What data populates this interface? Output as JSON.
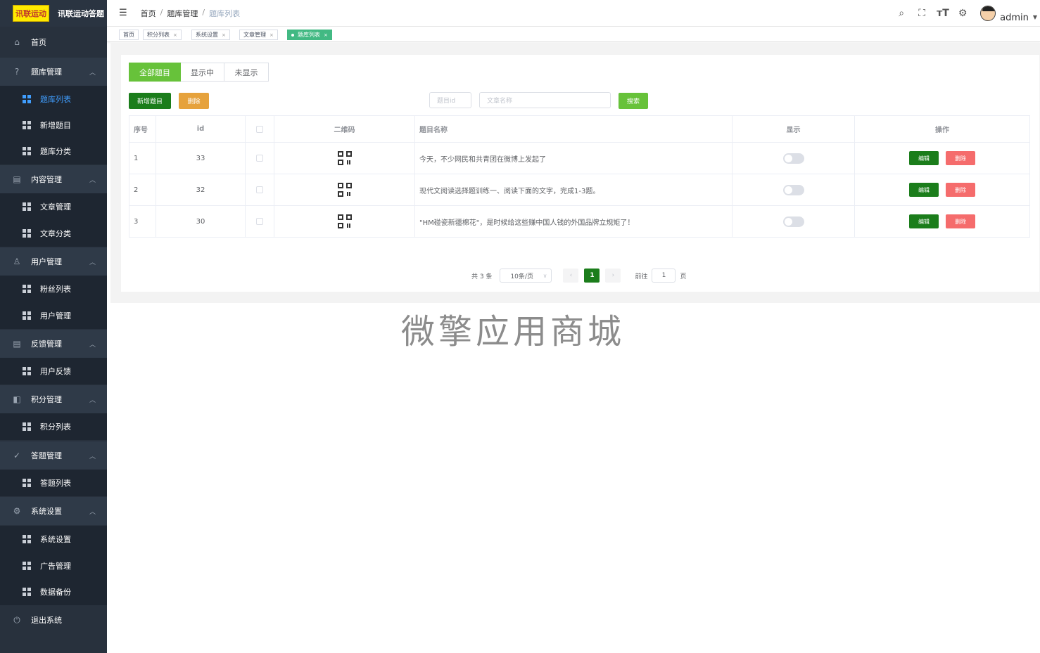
{
  "app": {
    "badge": "讯联运动",
    "title": "讯联运动答题"
  },
  "sidebar": {
    "items": [
      {
        "label": "首页",
        "icon": "home-icon",
        "glyph": "⌂"
      },
      {
        "label": "题库管理",
        "icon": "question-icon",
        "glyph": "?",
        "children": [
          {
            "label": "题库列表",
            "active": true
          },
          {
            "label": "新增题目"
          },
          {
            "label": "题库分类"
          }
        ]
      },
      {
        "label": "内容管理",
        "icon": "document-icon",
        "glyph": "▤",
        "children": [
          {
            "label": "文章管理"
          },
          {
            "label": "文章分类"
          }
        ]
      },
      {
        "label": "用户管理",
        "icon": "user-icon",
        "glyph": "♙",
        "children": [
          {
            "label": "粉丝列表"
          },
          {
            "label": "用户管理"
          }
        ]
      },
      {
        "label": "反馈管理",
        "icon": "feedback-icon",
        "glyph": "▤",
        "children": [
          {
            "label": "用户反馈"
          }
        ]
      },
      {
        "label": "积分管理",
        "icon": "points-icon",
        "glyph": "◧",
        "children": [
          {
            "label": "积分列表"
          }
        ]
      },
      {
        "label": "答题管理",
        "icon": "check-circle-icon",
        "glyph": "✓",
        "children": [
          {
            "label": "答题列表"
          }
        ]
      },
      {
        "label": "系统设置",
        "icon": "gear-icon",
        "glyph": "⚙",
        "children": [
          {
            "label": "系统设置"
          },
          {
            "label": "广告管理"
          },
          {
            "label": "数据备份"
          }
        ]
      },
      {
        "label": "退出系统",
        "icon": "power-icon",
        "glyph": "⏻"
      }
    ]
  },
  "header": {
    "breadcrumb": [
      "首页",
      "题库管理",
      "题库列表"
    ],
    "user": "admin"
  },
  "tags": [
    {
      "label": "首页",
      "closable": false
    },
    {
      "label": "积分列表",
      "closable": true
    },
    {
      "label": "系统设置",
      "closable": true
    },
    {
      "label": "文章管理",
      "closable": true
    },
    {
      "label": "题库列表",
      "closable": true,
      "active": true
    }
  ],
  "filter_tabs": [
    "全部题目",
    "显示中",
    "未显示"
  ],
  "toolbar": {
    "add_label": "新增题目",
    "delete_label": "删除",
    "id_placeholder": "题目id",
    "name_placeholder": "文章名称",
    "search_label": "搜索"
  },
  "table": {
    "columns": [
      "序号",
      "id",
      "",
      "二维码",
      "题目名称",
      "显示",
      "操作"
    ],
    "rows": [
      {
        "index": "1",
        "id": "33",
        "title": "今天，不少网民和共青团在微博上发起了",
        "shown": false
      },
      {
        "index": "2",
        "id": "32",
        "title": "现代文阅读选择题训练一、阅读下面的文字，完成1-3题。",
        "shown": false
      },
      {
        "index": "3",
        "id": "30",
        "title": "\"HM碰瓷新疆棉花\"，是时候给这些赚中国人钱的外国品牌立规矩了！",
        "shown": false
      }
    ],
    "edit_label": "编辑",
    "delete_label": "删除"
  },
  "pagination": {
    "total_text": "共 3 条",
    "page_size": "10条/页",
    "current_page": "1",
    "goto_label": "前往",
    "goto_value": "1",
    "page_unit": "页"
  },
  "watermark": "微擎应用商城",
  "colors": {
    "sidebar_bg": "#28313d",
    "active_link": "#409eff",
    "primary_green": "#1b7d1b",
    "light_green": "#67c23a",
    "warning": "#e6a23c",
    "danger": "#f56c6c",
    "tag_active": "#42b983"
  }
}
